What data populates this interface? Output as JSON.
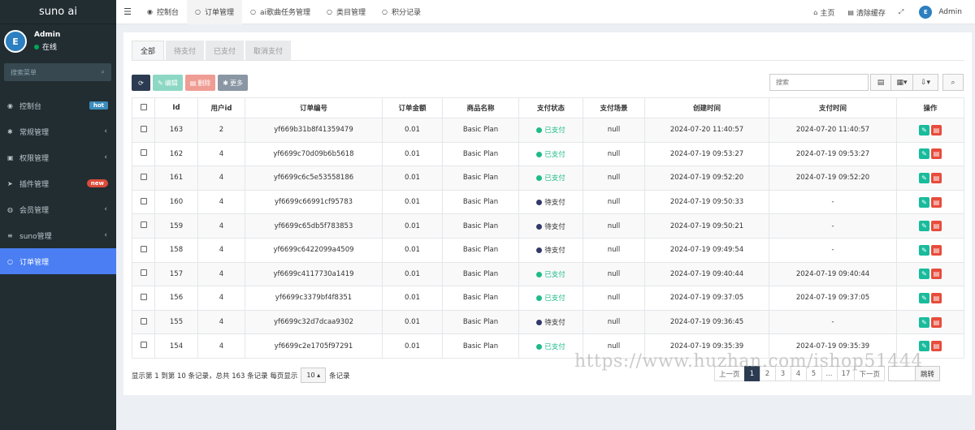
{
  "app": {
    "logo": "suno ai"
  },
  "user": {
    "name": "Admin",
    "status": "在线",
    "avatar_text": "E"
  },
  "sidebar": {
    "search_placeholder": "搜索菜单",
    "items": [
      {
        "label": "控制台",
        "icon": "dashboard-icon",
        "glyph": "◉",
        "badge": "hot"
      },
      {
        "label": "常规管理",
        "icon": "cogs-icon",
        "glyph": "✱",
        "chevron": "‹"
      },
      {
        "label": "权限管理",
        "icon": "group-icon",
        "glyph": "▣",
        "chevron": "‹"
      },
      {
        "label": "插件管理",
        "icon": "rocket-icon",
        "glyph": "➤",
        "badge": "new"
      },
      {
        "label": "会员管理",
        "icon": "user-circle-icon",
        "glyph": "◍",
        "chevron": "‹"
      },
      {
        "label": "suno管理",
        "icon": "list-icon",
        "glyph": "≡",
        "chevron": "‹"
      },
      {
        "label": "订单管理",
        "icon": "circle-icon",
        "glyph": "○",
        "active": true
      }
    ]
  },
  "topbar": {
    "tabs": [
      {
        "label": "控制台",
        "icon": "dashboard-icon",
        "glyph": "◉"
      },
      {
        "label": "订单管理",
        "icon": "circle-icon",
        "glyph": "○",
        "active": true
      },
      {
        "label": "ai歌曲任务管理",
        "icon": "circle-icon",
        "glyph": "○"
      },
      {
        "label": "类目管理",
        "icon": "circle-icon",
        "glyph": "○"
      },
      {
        "label": "积分记录",
        "icon": "circle-icon",
        "glyph": "○"
      }
    ],
    "home_label": "主页",
    "clear_cache_label": "清除缓存",
    "admin_label": "Admin"
  },
  "subtabs": [
    "全部",
    "待支付",
    "已支付",
    "取消支付"
  ],
  "toolbar": {
    "edit_label": "编辑",
    "delete_label": "删除",
    "more_label": "更多",
    "search_placeholder": "搜索"
  },
  "table": {
    "headers": [
      "Id",
      "用户id",
      "订单编号",
      "订单金额",
      "商品名称",
      "支付状态",
      "支付场景",
      "创建时间",
      "支付时间",
      "操作"
    ],
    "rows": [
      {
        "id": "163",
        "user_id": "2",
        "order_no": "yf669b31b8f41359479",
        "amount": "0.01",
        "product": "Basic Plan",
        "status": "已支付",
        "paid": true,
        "scene": "null",
        "created": "2024-07-20 11:40:57",
        "pay_time": "2024-07-20 11:40:57"
      },
      {
        "id": "162",
        "user_id": "4",
        "order_no": "yf6699c70d09b6b5618",
        "amount": "0.01",
        "product": "Basic Plan",
        "status": "已支付",
        "paid": true,
        "scene": "null",
        "created": "2024-07-19 09:53:27",
        "pay_time": "2024-07-19 09:53:27"
      },
      {
        "id": "161",
        "user_id": "4",
        "order_no": "yf6699c6c5e53558186",
        "amount": "0.01",
        "product": "Basic Plan",
        "status": "已支付",
        "paid": true,
        "scene": "null",
        "created": "2024-07-19 09:52:20",
        "pay_time": "2024-07-19 09:52:20"
      },
      {
        "id": "160",
        "user_id": "4",
        "order_no": "yf6699c66991cf95783",
        "amount": "0.01",
        "product": "Basic Plan",
        "status": "待支付",
        "paid": false,
        "scene": "null",
        "created": "2024-07-19 09:50:33",
        "pay_time": "-"
      },
      {
        "id": "159",
        "user_id": "4",
        "order_no": "yf6699c65db5f783853",
        "amount": "0.01",
        "product": "Basic Plan",
        "status": "待支付",
        "paid": false,
        "scene": "null",
        "created": "2024-07-19 09:50:21",
        "pay_time": "-"
      },
      {
        "id": "158",
        "user_id": "4",
        "order_no": "yf6699c6422099a4509",
        "amount": "0.01",
        "product": "Basic Plan",
        "status": "待支付",
        "paid": false,
        "scene": "null",
        "created": "2024-07-19 09:49:54",
        "pay_time": "-"
      },
      {
        "id": "157",
        "user_id": "4",
        "order_no": "yf6699c4117730a1419",
        "amount": "0.01",
        "product": "Basic Plan",
        "status": "已支付",
        "paid": true,
        "scene": "null",
        "created": "2024-07-19 09:40:44",
        "pay_time": "2024-07-19 09:40:44"
      },
      {
        "id": "156",
        "user_id": "4",
        "order_no": "yf6699c3379bf4f8351",
        "amount": "0.01",
        "product": "Basic Plan",
        "status": "已支付",
        "paid": true,
        "scene": "null",
        "created": "2024-07-19 09:37:05",
        "pay_time": "2024-07-19 09:37:05"
      },
      {
        "id": "155",
        "user_id": "4",
        "order_no": "yf6699c32d7dcaa9302",
        "amount": "0.01",
        "product": "Basic Plan",
        "status": "待支付",
        "paid": false,
        "scene": "null",
        "created": "2024-07-19 09:36:45",
        "pay_time": "-"
      },
      {
        "id": "154",
        "user_id": "4",
        "order_no": "yf6699c2e1705f97291",
        "amount": "0.01",
        "product": "Basic Plan",
        "status": "已支付",
        "paid": true,
        "scene": "null",
        "created": "2024-07-19 09:35:39",
        "pay_time": "2024-07-19 09:35:39"
      }
    ]
  },
  "pagination": {
    "info_prefix": "显示第 1 到第 10 条记录，总共 163 条记录 每页显示",
    "page_size": "10",
    "info_suffix": "条记录",
    "prev_label": "上一页",
    "next_label": "下一页",
    "pages": [
      "1",
      "2",
      "3",
      "4",
      "5",
      "...",
      "17"
    ],
    "current": "1",
    "jump_label": "跳转"
  },
  "watermark": "https://www.huzhan.com/ishop51444"
}
